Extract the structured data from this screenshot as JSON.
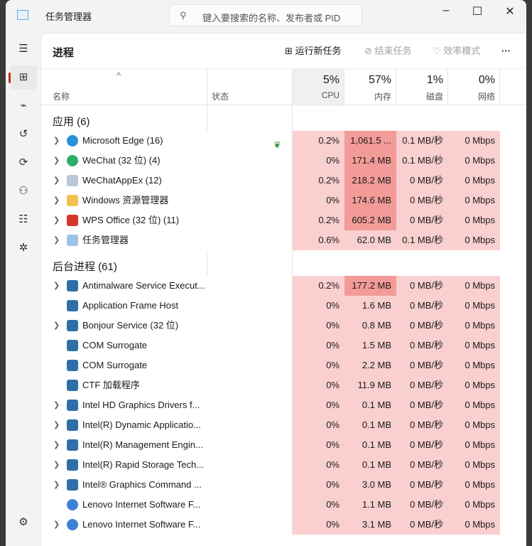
{
  "window": {
    "title": "任务管理器",
    "search_placeholder": "键入要搜索的名称、发布者或 PID"
  },
  "toolbar": {
    "page_title": "进程",
    "run_new_task": "运行新任务",
    "end_task": "结束任务",
    "efficiency_mode": "效率模式",
    "more": "···"
  },
  "columns": {
    "name": "名称",
    "status": "状态",
    "cpu": {
      "pct": "5%",
      "label": "CPU"
    },
    "memory": {
      "pct": "57%",
      "label": "内存"
    },
    "disk": {
      "pct": "1%",
      "label": "磁盘"
    },
    "network": {
      "pct": "0%",
      "label": "网络"
    }
  },
  "groups": [
    {
      "title": "应用 (6)",
      "rows": [
        {
          "name": "Microsoft Edge (16)",
          "expand": true,
          "icon": "edge",
          "eco": true,
          "cpu": "0.2%",
          "mem": "1,061.5 ...",
          "disk": "0.1 MB/秒",
          "net": "0 Mbps",
          "hot": true
        },
        {
          "name": "WeChat (32 位) (4)",
          "expand": true,
          "icon": "wechat",
          "cpu": "0%",
          "mem": "171.4 MB",
          "disk": "0.1 MB/秒",
          "net": "0 Mbps",
          "hot": true
        },
        {
          "name": "WeChatAppEx (12)",
          "expand": true,
          "icon": "wechatappex",
          "cpu": "0.2%",
          "mem": "218.2 MB",
          "disk": "0 MB/秒",
          "net": "0 Mbps",
          "hot": true
        },
        {
          "name": "Windows 资源管理器",
          "expand": true,
          "icon": "folder",
          "cpu": "0%",
          "mem": "174.6 MB",
          "disk": "0 MB/秒",
          "net": "0 Mbps",
          "hot": true
        },
        {
          "name": "WPS Office (32 位) (11)",
          "expand": true,
          "icon": "wps",
          "cpu": "0.2%",
          "mem": "605.2 MB",
          "disk": "0 MB/秒",
          "net": "0 Mbps",
          "hot": true
        },
        {
          "name": "任务管理器",
          "expand": true,
          "icon": "taskmgr",
          "cpu": "0.6%",
          "mem": "62.0 MB",
          "disk": "0.1 MB/秒",
          "net": "0 Mbps"
        }
      ]
    },
    {
      "title": "后台进程 (61)",
      "rows": [
        {
          "name": "Antimalware Service Execut...",
          "expand": true,
          "icon": "service",
          "cpu": "0.2%",
          "mem": "177.2 MB",
          "disk": "0 MB/秒",
          "net": "0 Mbps",
          "hot": true
        },
        {
          "name": "Application Frame Host",
          "icon": "service",
          "cpu": "0%",
          "mem": "1.6 MB",
          "disk": "0 MB/秒",
          "net": "0 Mbps"
        },
        {
          "name": "Bonjour Service (32 位)",
          "expand": true,
          "icon": "service",
          "cpu": "0%",
          "mem": "0.8 MB",
          "disk": "0 MB/秒",
          "net": "0 Mbps"
        },
        {
          "name": "COM Surrogate",
          "icon": "service",
          "cpu": "0%",
          "mem": "1.5 MB",
          "disk": "0 MB/秒",
          "net": "0 Mbps"
        },
        {
          "name": "COM Surrogate",
          "icon": "service",
          "cpu": "0%",
          "mem": "2.2 MB",
          "disk": "0 MB/秒",
          "net": "0 Mbps"
        },
        {
          "name": "CTF 加载程序",
          "icon": "service",
          "cpu": "0%",
          "mem": "11.9 MB",
          "disk": "0 MB/秒",
          "net": "0 Mbps"
        },
        {
          "name": "Intel HD Graphics Drivers f...",
          "expand": true,
          "icon": "service",
          "cpu": "0%",
          "mem": "0.1 MB",
          "disk": "0 MB/秒",
          "net": "0 Mbps"
        },
        {
          "name": "Intel(R) Dynamic Applicatio...",
          "expand": true,
          "icon": "service",
          "cpu": "0%",
          "mem": "0.1 MB",
          "disk": "0 MB/秒",
          "net": "0 Mbps"
        },
        {
          "name": "Intel(R) Management Engin...",
          "expand": true,
          "icon": "service",
          "cpu": "0%",
          "mem": "0.1 MB",
          "disk": "0 MB/秒",
          "net": "0 Mbps"
        },
        {
          "name": "Intel(R) Rapid Storage Tech...",
          "expand": true,
          "icon": "service",
          "cpu": "0%",
          "mem": "0.1 MB",
          "disk": "0 MB/秒",
          "net": "0 Mbps"
        },
        {
          "name": "Intel® Graphics Command ...",
          "expand": true,
          "icon": "service",
          "cpu": "0%",
          "mem": "3.0 MB",
          "disk": "0 MB/秒",
          "net": "0 Mbps"
        },
        {
          "name": "Lenovo Internet Software F...",
          "icon": "lenovo",
          "cpu": "0%",
          "mem": "1.1 MB",
          "disk": "0 MB/秒",
          "net": "0 Mbps"
        },
        {
          "name": "Lenovo Internet Software F...",
          "expand": true,
          "icon": "lenovo",
          "cpu": "0%",
          "mem": "3.1 MB",
          "disk": "0 MB/秒",
          "net": "0 Mbps"
        }
      ]
    }
  ]
}
